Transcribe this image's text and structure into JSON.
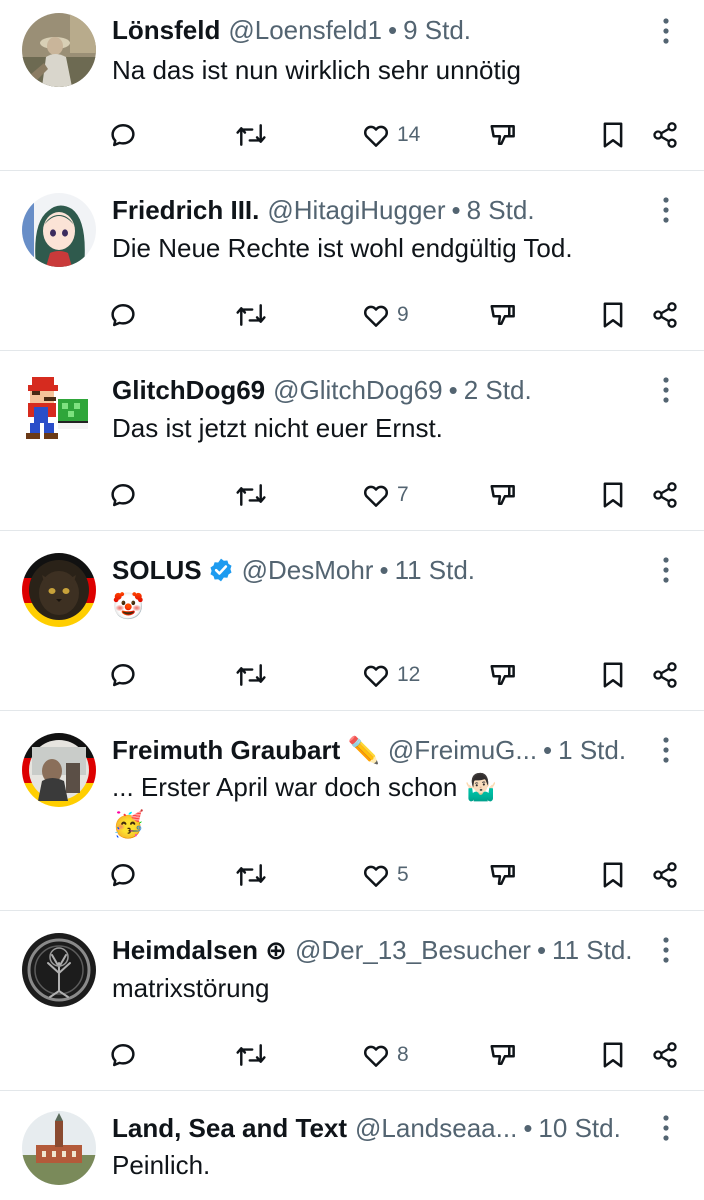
{
  "replies": [
    {
      "name": "Lönsfeld",
      "handle": "@Loensfeld1",
      "time": "9 Std.",
      "text": "Na das ist nun wirklich sehr unnötig",
      "likes": "14",
      "avatar": "photo-person-outdoor"
    },
    {
      "name": "Friedrich III.",
      "handle": "@HitagiHugger",
      "time": "8 Std.",
      "text": "Die Neue Rechte ist wohl endgültig Tod.",
      "likes": "9",
      "avatar": "anime-girl"
    },
    {
      "name": "GlitchDog69",
      "handle": "@GlitchDog69",
      "time": "2 Std.",
      "text": "Das ist jetzt nicht euer Ernst.",
      "likes": "7",
      "avatar": "pixel-mario-shell"
    },
    {
      "name": "SOLUS",
      "handle": "@DesMohr",
      "time": "11 Std.",
      "text": "🤡",
      "likes": "12",
      "verified": true,
      "avatar": "cat-german-flag-ring"
    },
    {
      "name": "Freimuth Graubart ✏️",
      "handle": "@FreimuG...",
      "time": "1 Std.",
      "text": "... Erster April war doch schon 🤷🏻‍♂️",
      "text2": "🥳",
      "likes": "5",
      "avatar": "person-german-flag-ring"
    },
    {
      "name": "Heimdalsen ⊕",
      "handle": "@Der_13_Besucher",
      "time": "11 Std.",
      "text": "matrixstörung",
      "likes": "8",
      "avatar": "dark-tree-emblem"
    },
    {
      "name": "Land, Sea and Text",
      "handle": "@Landseaa...",
      "time": "10 Std.",
      "text": "Peinlich.",
      "avatar": "castle-photo"
    }
  ],
  "icons": {
    "reply": "reply-icon",
    "retweet": "retweet-icon",
    "like": "heart-icon",
    "dislike": "dislike-icon",
    "bookmark": "bookmark-icon",
    "share": "share-icon",
    "more": "more-icon",
    "verified": "verified-badge-icon"
  },
  "colors": {
    "text": "#0f1419",
    "muted": "#536471",
    "divider": "#e3e7ea",
    "verified": "#1d9bf0"
  }
}
